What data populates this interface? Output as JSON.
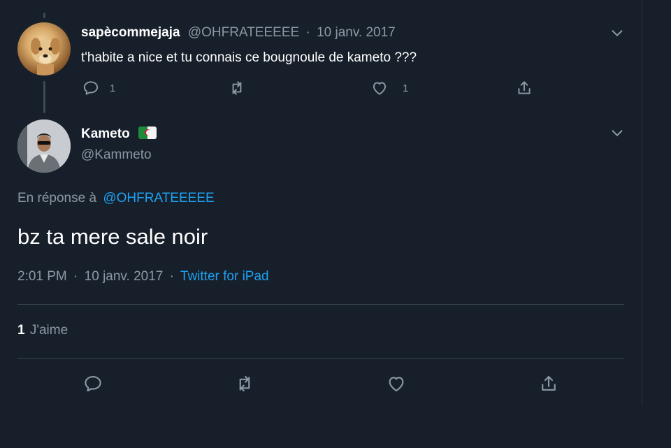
{
  "reply_tweet": {
    "display_name": "sapècommejaja",
    "handle": "@OHFRATEEEEE",
    "separator": "·",
    "date": "10 janv. 2017",
    "text": "t'habite a nice et tu connais ce bougnoule de kameto ???",
    "reply_count": "1",
    "like_count": "1"
  },
  "main_tweet": {
    "display_name": "Kameto",
    "flag_icon": "algeria-flag-icon",
    "handle": "@Kammeto",
    "in_reply_prefix": "En réponse à",
    "in_reply_handle": "@OHFRATEEEEE",
    "text": "bz ta mere sale noir",
    "time": "2:01 PM",
    "separator": "·",
    "date": "10 janv. 2017",
    "source": "Twitter for iPad",
    "like_count": "1",
    "like_label": "J'aime"
  },
  "colors": {
    "background": "#17202a",
    "text": "#ffffff",
    "muted": "#8b98a5",
    "link": "#1da1f2"
  },
  "icons": [
    "reply-icon",
    "retweet-icon",
    "like-icon",
    "share-icon",
    "chevron-down-icon"
  ]
}
